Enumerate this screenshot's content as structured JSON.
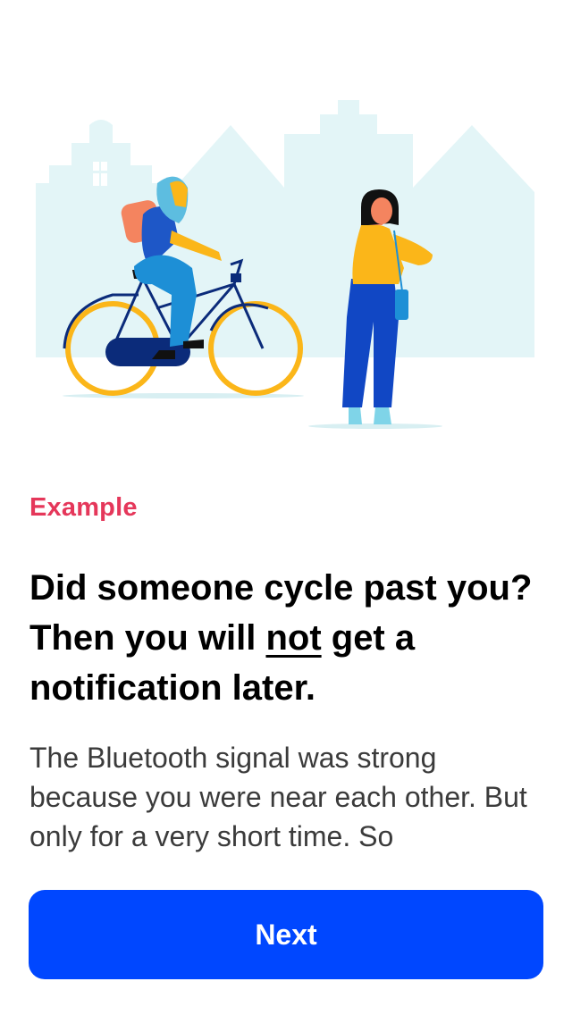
{
  "eyebrow": "Example",
  "headline": {
    "part1": "Did someone cycle past you? Then you will ",
    "emphasis": "not",
    "part2": " get a notification later."
  },
  "body": "The Bluetooth signal was strong because you were near each other. But only for a very short time. So",
  "next_label": "Next",
  "colors": {
    "accent_red": "#e5375a",
    "primary_blue": "#0047ff",
    "sky": "#e3f5f7",
    "wheel_yellow": "#fbb619",
    "navy": "#0b2b7a"
  },
  "illustration": {
    "icon": "cyclist-passing-pedestrian-illustration"
  }
}
